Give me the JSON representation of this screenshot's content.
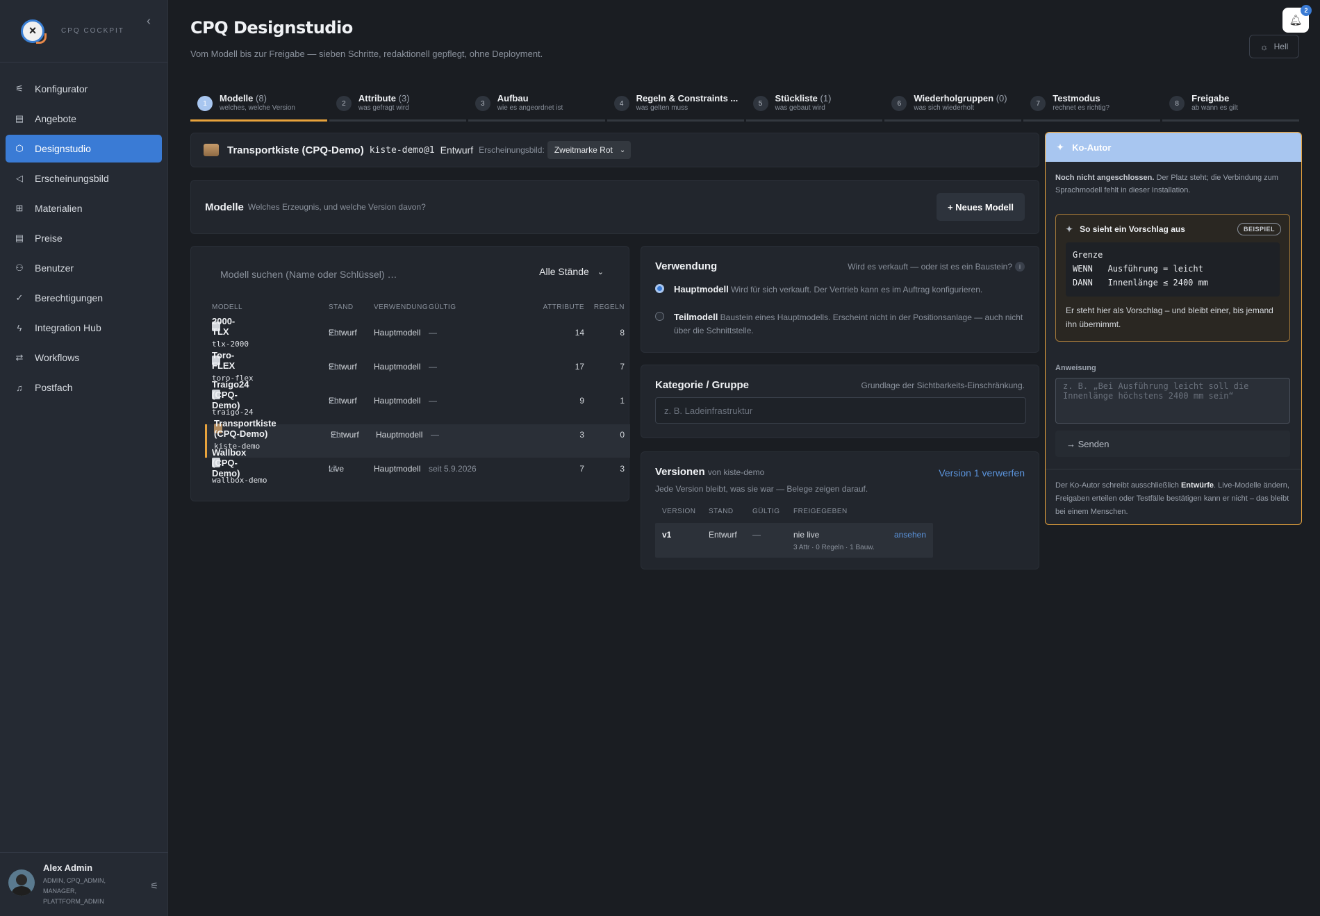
{
  "brand": {
    "name": "CPQ COCKPIT"
  },
  "sidebar": {
    "items": [
      {
        "label": "Konfigurator",
        "icon": "sliders-icon"
      },
      {
        "label": "Angebote",
        "icon": "document-icon"
      },
      {
        "label": "Designstudio",
        "icon": "cube-icon",
        "active": true
      },
      {
        "label": "Erscheinungsbild",
        "icon": "megaphone-icon"
      },
      {
        "label": "Materialien",
        "icon": "grid-icon"
      },
      {
        "label": "Preise",
        "icon": "receipt-icon"
      },
      {
        "label": "Benutzer",
        "icon": "user-plus-icon"
      },
      {
        "label": "Berechtigungen",
        "icon": "check-circle-icon"
      },
      {
        "label": "Integration Hub",
        "icon": "bolt-icon"
      },
      {
        "label": "Workflows",
        "icon": "flow-icon"
      },
      {
        "label": "Postfach",
        "icon": "bell-icon"
      }
    ]
  },
  "user": {
    "name": "Alex Admin",
    "roles": "ADMIN, CPQ_ADMIN, MANAGER, PLATTFORM_ADMIN"
  },
  "header": {
    "title": "CPQ Designstudio",
    "subtitle": "Vom Modell bis zur Freigabe — sieben Schritte, redaktionell gepflegt, ohne Deployment.",
    "notifications": "2",
    "theme_label": "Hell"
  },
  "steps": [
    {
      "num": "1",
      "title": "Modelle",
      "count": "(8)",
      "sub": "welches, welche Version",
      "active": true
    },
    {
      "num": "2",
      "title": "Attribute",
      "count": "(3)",
      "sub": "was gefragt wird"
    },
    {
      "num": "3",
      "title": "Aufbau",
      "count": "",
      "sub": "wie es angeordnet ist"
    },
    {
      "num": "4",
      "title": "Regeln & Constraints ...",
      "count": "",
      "sub": "was gelten muss"
    },
    {
      "num": "5",
      "title": "Stückliste",
      "count": "(1)",
      "sub": "was gebaut wird"
    },
    {
      "num": "6",
      "title": "Wiederholgruppen",
      "count": "(0)",
      "sub": "was sich wiederholt"
    },
    {
      "num": "7",
      "title": "Testmodus",
      "count": "",
      "sub": "rechnet es richtig?"
    },
    {
      "num": "8",
      "title": "Freigabe",
      "count": "",
      "sub": "ab wann es gilt"
    }
  ],
  "model_bar": {
    "name": "Transportkiste (CPQ-Demo)",
    "key": "kiste-demo@1",
    "stand": "Entwurf",
    "appearance_label": "Erscheinungsbild:",
    "appearance_value": "Zweitmarke Rot"
  },
  "models_head": {
    "title": "Modelle",
    "subtitle": "Welches Erzeugnis, und welche Version davon?",
    "new_button": "+ Neues Modell"
  },
  "model_list": {
    "search_placeholder": "Modell suchen (Name oder Schlüssel) …",
    "filter": "Alle Stände",
    "columns": [
      "MODELL",
      "STAND",
      "VERWENDUNG",
      "GÜLTIG",
      "ATTRIBUTE",
      "REGELN"
    ],
    "rows": [
      {
        "name": "2000-TLX",
        "key": "tlx-2000",
        "stand": "Entwurf",
        "version": "v1",
        "use": "Hauptmodell",
        "valid": "—",
        "attributes": "14",
        "rules": "8"
      },
      {
        "name": "Toro-FLEX",
        "key": "toro-flex",
        "stand": "Entwurf",
        "version": "v1",
        "use": "Hauptmodell",
        "valid": "—",
        "attributes": "17",
        "rules": "7"
      },
      {
        "name": "Traigo24 (CPQ-Demo)",
        "key": "traigo-24",
        "stand": "Entwurf",
        "version": "v1",
        "use": "Hauptmodell",
        "valid": "—",
        "attributes": "9",
        "rules": "1"
      },
      {
        "name": "Transportkiste (CPQ-Demo)",
        "key": "kiste-demo",
        "stand": "Entwurf",
        "version": "v1",
        "use": "Hauptmodell",
        "valid": "—",
        "attributes": "3",
        "rules": "0",
        "selected": true
      },
      {
        "name": "Wallbox (CPQ-Demo)",
        "key": "wallbox-demo",
        "stand": "Live",
        "version": "v4",
        "use": "Hauptmodell",
        "valid": "seit 5.9.2026",
        "attributes": "7",
        "rules": "3"
      }
    ]
  },
  "usage": {
    "title": "Verwendung",
    "hint": "Wird es verkauft — oder ist es ein Baustein?",
    "options": [
      {
        "label": "Hauptmodell",
        "desc": "Wird für sich verkauft. Der Vertrieb kann es im Auftrag konfigurieren.",
        "checked": true
      },
      {
        "label": "Teilmodell",
        "desc": "Baustein eines Hauptmodells. Erscheint nicht in der Positionsanlage — auch nicht über die Schnittstelle.",
        "checked": false
      }
    ]
  },
  "category": {
    "title": "Kategorie / Gruppe",
    "hint": "Grundlage der Sichtbarkeits-Einschränkung.",
    "placeholder": "z. B. Ladeinfrastruktur"
  },
  "versions": {
    "title": "Versionen",
    "of": "von kiste-demo",
    "discard_link": "Version 1 verwerfen",
    "subtitle": "Jede Version bleibt, was sie war — Belege zeigen darauf.",
    "columns": [
      "VERSION",
      "STAND",
      "GÜLTIG",
      "FREIGEGEBEN"
    ],
    "row": {
      "version": "v1",
      "stand": "Entwurf",
      "valid": "—",
      "released": "nie live",
      "detail": "3 Attr · 0 Regeln · 1 Bauw.",
      "action": "ansehen"
    }
  },
  "coauthor": {
    "title": "Ko-Autor",
    "note_bold": "Noch nicht angeschlossen.",
    "note": " Der Platz steht; die Verbindung zum Sprachmodell fehlt in dieser Installation.",
    "example_title": "So sieht ein Vorschlag aus",
    "example_badge": "BEISPIEL",
    "example_code": "Grenze\nWENN   Ausführung = leicht\nDANN   Innenlänge ≤ 2400 mm",
    "example_text": "Er steht hier als Vorschlag – und bleibt einer, bis jemand ihn übernimmt.",
    "instruction_label": "Anweisung",
    "instruction_placeholder": "z. B. „Bei Ausführung leicht soll die Innenlänge höchstens 2400 mm sein“",
    "send": "→ Senden",
    "footer_pre": "Der Ko-Autor schreibt ausschließlich ",
    "footer_bold": "Entwürfe",
    "footer_post": ". Live-Modelle ändern, Freigaben erteilen oder Testfälle bestätigen kann er nicht – das bleibt bei einem Menschen."
  },
  "colors": {
    "accent": "#3a7bd5",
    "highlight": "#e8a33c",
    "background": "#1a1d22"
  }
}
